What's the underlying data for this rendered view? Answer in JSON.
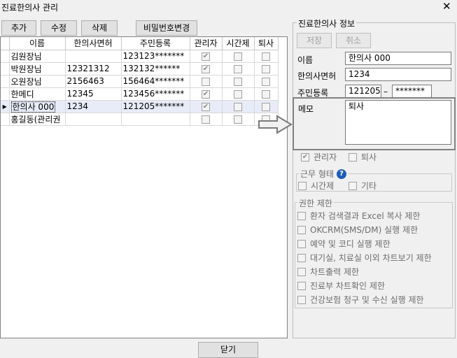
{
  "window": {
    "title": "진료한의사 관리",
    "close": "✕"
  },
  "toolbar": {
    "add": "추가",
    "edit": "수정",
    "delete": "삭제",
    "change_password": "비밀번호변경"
  },
  "grid": {
    "columns": [
      "이름",
      "한의사면허",
      "주민등록",
      "관리자",
      "시간제",
      "퇴사"
    ],
    "rows": [
      {
        "name": "김원장님",
        "license": "",
        "ssn": "123123*******",
        "admin": true,
        "parttime": false,
        "retired": false,
        "selected": false
      },
      {
        "name": "박원장님",
        "license": "12321312",
        "ssn": "132132******",
        "admin": true,
        "parttime": false,
        "retired": false,
        "selected": false
      },
      {
        "name": "오원장님",
        "license": "2156463",
        "ssn": "156464*******",
        "admin": false,
        "parttime": false,
        "retired": false,
        "selected": false
      },
      {
        "name": "한메디",
        "license": "12345",
        "ssn": "123456*******",
        "admin": true,
        "parttime": false,
        "retired": false,
        "selected": false
      },
      {
        "name": "한의사 000",
        "license": "1234",
        "ssn": "121205*******",
        "admin": true,
        "parttime": false,
        "retired": false,
        "selected": true
      },
      {
        "name": "홍길동(관리권",
        "license": "",
        "ssn": "",
        "admin": false,
        "parttime": false,
        "retired": false,
        "selected": false
      }
    ]
  },
  "info": {
    "legend": "진료한의사 정보",
    "save": "저장",
    "cancel": "취소",
    "name_label": "이름",
    "name_value": "한의사 000",
    "license_label": "한의사면허",
    "license_value": "1234",
    "ssn_label": "주민등록",
    "ssn_front": "121205",
    "ssn_dash": "–",
    "ssn_back": "*******",
    "memo_label": "메모",
    "memo_value": "퇴사",
    "admin_label": "관리자",
    "retired_label": "퇴사",
    "admin_checked": true,
    "retired_checked": false
  },
  "work_type": {
    "legend": "근무 형태",
    "help": "?",
    "parttime": "시간제",
    "other": "기타"
  },
  "permissions": {
    "legend": "권한 제한",
    "items": [
      "환자 검색결과 Excel 복사 제한",
      "OKCRM(SMS/DM) 실행 제한",
      "예약 및 코디 실행 제한",
      "대기실, 치료실 이외 차트보기 제한",
      "차트출력 제한",
      "진료부 차트확인 제한",
      "건강보험 청구 및 수신 실행 제한"
    ]
  },
  "footer": {
    "close": "닫기"
  }
}
